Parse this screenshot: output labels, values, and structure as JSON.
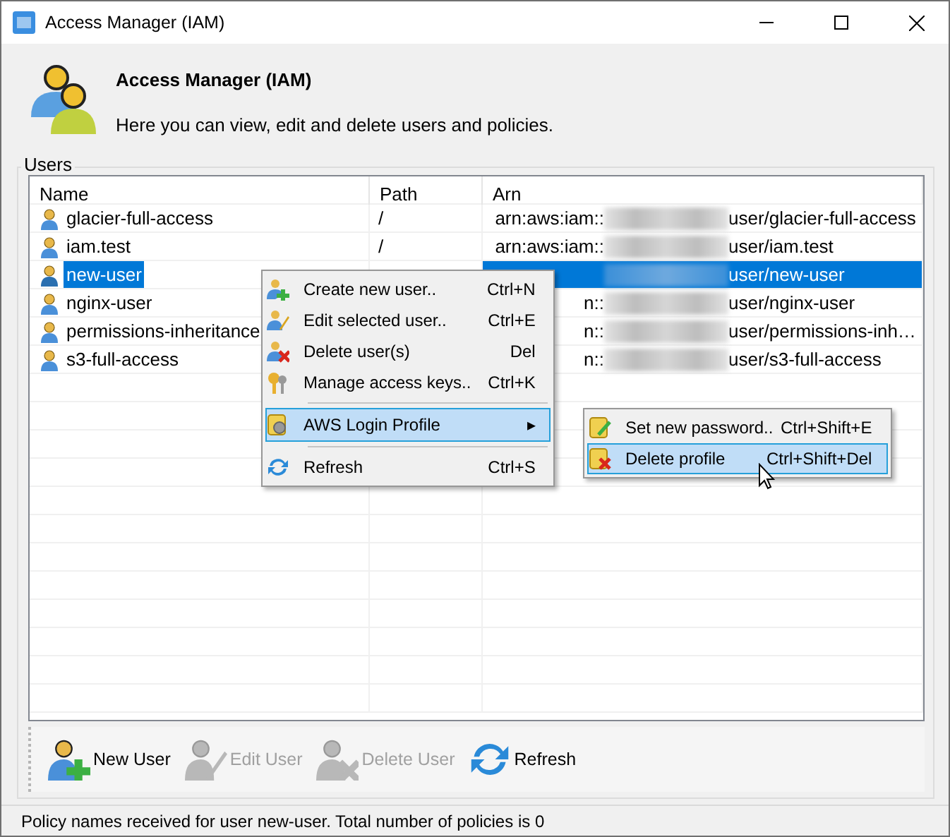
{
  "window": {
    "title": "Access Manager (IAM)"
  },
  "header": {
    "title": "Access Manager (IAM)",
    "subtitle": "Here you can view, edit and delete users and policies."
  },
  "group": {
    "label": "Users"
  },
  "table": {
    "columns": [
      "Name",
      "Path",
      "Arn"
    ],
    "rows": [
      {
        "name": "glacier-full-access",
        "path": "/",
        "arn_prefix": "arn:aws:iam::",
        "arn_suffix": "user/glacier-full-access",
        "selected": false
      },
      {
        "name": "iam.test",
        "path": "/",
        "arn_prefix": "arn:aws:iam::",
        "arn_suffix": "user/iam.test",
        "selected": false
      },
      {
        "name": "new-user",
        "arn_suffix": "user/new-user",
        "selected": true
      },
      {
        "name": "nginx-user",
        "arn_prefix": "n::",
        "arn_suffix": "user/nginx-user",
        "selected": false
      },
      {
        "name": "permissions-inheritance",
        "arn_prefix": "n::",
        "arn_suffix": "user/permissions-inh…",
        "selected": false
      },
      {
        "name": "s3-full-access",
        "arn_prefix": "n::",
        "arn_suffix": "user/s3-full-access",
        "selected": false
      }
    ]
  },
  "context_menu": {
    "groups": [
      [
        {
          "label": "Create new user..",
          "shortcut": "Ctrl+N",
          "selected": false
        },
        {
          "label": "Edit selected user..",
          "shortcut": "Ctrl+E",
          "selected": false
        },
        {
          "label": "Delete user(s)",
          "shortcut": "Del",
          "selected": false
        },
        {
          "label": "Manage access keys..",
          "shortcut": "Ctrl+K",
          "selected": false
        }
      ],
      [
        {
          "label": "AWS Login Profile",
          "arrow": "▸",
          "selected": true
        }
      ],
      [
        {
          "label": "Refresh",
          "shortcut": "Ctrl+S",
          "selected": false
        }
      ]
    ]
  },
  "submenu": {
    "items": [
      {
        "label": "Set new password..",
        "shortcut": "Ctrl+Shift+E",
        "selected": false
      },
      {
        "label": "Delete profile",
        "shortcut": "Ctrl+Shift+Del",
        "selected": true
      }
    ]
  },
  "toolbar": [
    {
      "label": "New User",
      "disabled": false
    },
    {
      "label": "Edit User",
      "disabled": true
    },
    {
      "label": "Delete User",
      "disabled": true
    },
    {
      "label": "Refresh",
      "disabled": false
    }
  ],
  "status_bar": "Policy names received for user new-user. Total number of policies is 0"
}
